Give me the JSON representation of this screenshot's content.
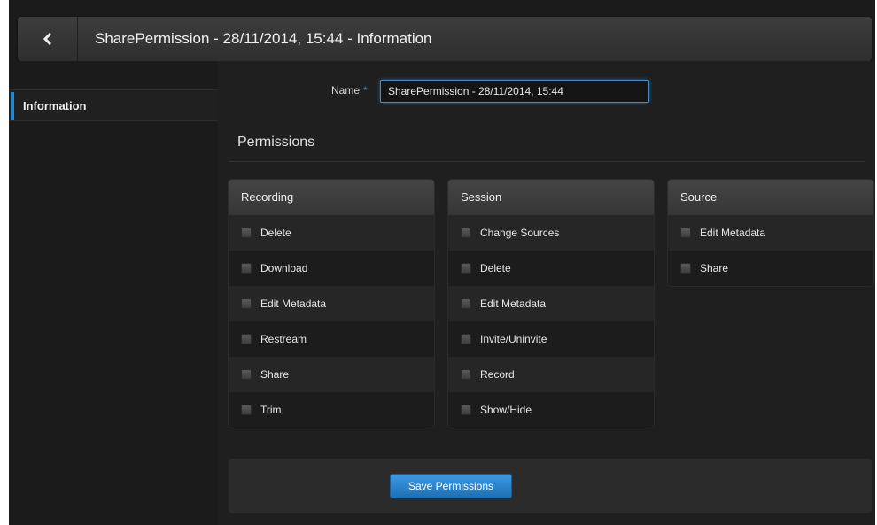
{
  "header": {
    "back_icon": "chevron-left-icon",
    "title": "SharePermission - 28/11/2014, 15:44 - Information"
  },
  "sidebar": {
    "items": [
      {
        "label": "Information",
        "active": true
      }
    ]
  },
  "form": {
    "name_label": "Name",
    "required_marker": "*",
    "name_value": "SharePermission - 28/11/2014, 15:44"
  },
  "permissions": {
    "title": "Permissions",
    "groups": [
      {
        "title": "Recording",
        "items": [
          "Delete",
          "Download",
          "Edit Metadata",
          "Restream",
          "Share",
          "Trim"
        ]
      },
      {
        "title": "Session",
        "items": [
          "Change Sources",
          "Delete",
          "Edit Metadata",
          "Invite/Uninvite",
          "Record",
          "Show/Hide"
        ]
      },
      {
        "title": "Source",
        "items": [
          "Edit Metadata",
          "Share"
        ]
      }
    ]
  },
  "actions": {
    "save_label": "Save Permissions"
  },
  "colors": {
    "accent": "#2a87c9",
    "background": "#1b1b1b",
    "panel_header": "#3d3d3d"
  }
}
